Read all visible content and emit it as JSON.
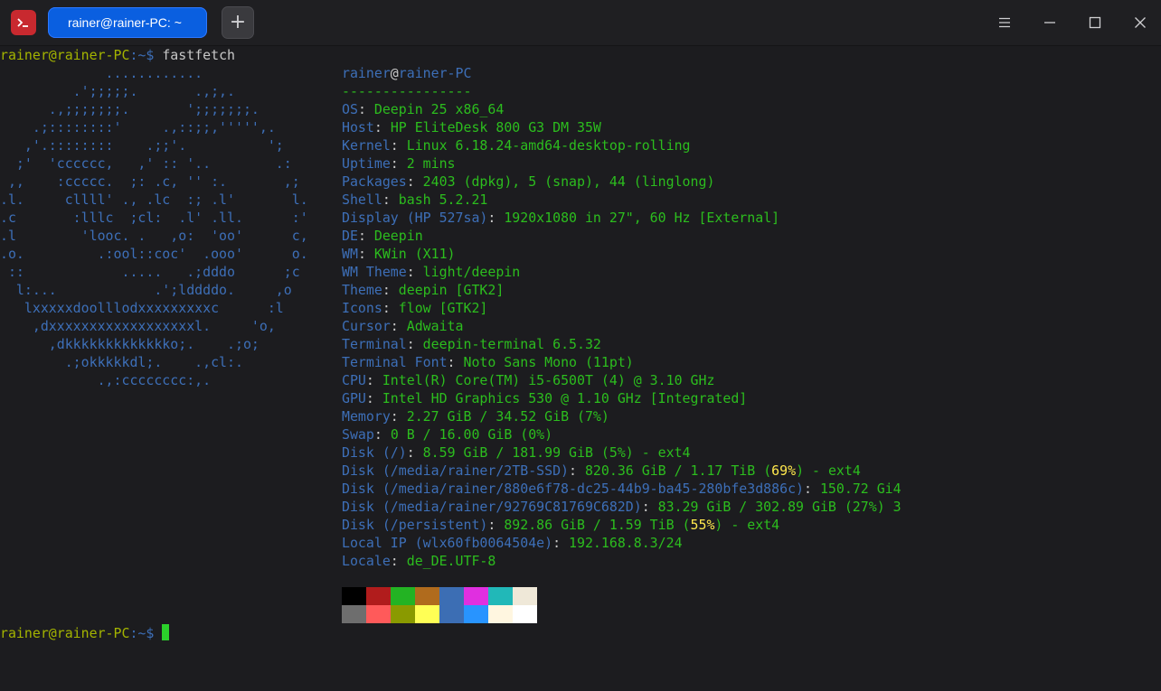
{
  "window": {
    "tab_label": "rainer@rainer-PC: ~",
    "tab_close_glyph": "×",
    "new_tab_glyph": "+",
    "icons": [
      "terminal-app-icon",
      "tab-close-icon",
      "plus-icon",
      "hamburger-menu-icon",
      "minimize-icon",
      "maximize-icon",
      "close-icon"
    ]
  },
  "prompt": {
    "user_host": "rainer@rainer-PC",
    "path": ":~$ ",
    "command": "fastfetch"
  },
  "ascii_art": [
    "             ............",
    "         .';;;;;.       .,;,.",
    "      .,;;;;;;;.       ';;;;;;;.",
    "    .;::::::::'     .,::;;,''''',.",
    "   ,'.::::::::    .;;'.          ';",
    "  ;'  'cccccc,   ,' :: '..        .:",
    " ,,    :ccccc.  ;: .c, '' :.       ,;",
    ".l.     cllll' ., .lc  :; .l'       l.",
    ".c       :lllc  ;cl:  .l' .ll.      :'",
    ".l        'looc. .   ,o:  'oo'      c,",
    ".o.         .:ool::coc'  .ooo'      o.",
    " ::            .....   .;dddo      ;c",
    "  l:...            .';lddddo.     ,o",
    "   lxxxxxdoolllodxxxxxxxxxc      :l",
    "    ,dxxxxxxxxxxxxxxxxxxl.     'o,",
    "      ,dkkkkkkkkkkkkko;.    .;o;",
    "        .;okkkkkdl;.    .,cl:.",
    "            .,:cccccccc:,."
  ],
  "info": {
    "user": "rainer",
    "at": "@",
    "host": "rainer-PC",
    "separator": "----------------",
    "rows": [
      {
        "key": "OS",
        "sep": ": ",
        "value": "Deepin 25 x86_64"
      },
      {
        "key": "Host",
        "sep": ": ",
        "value": "HP EliteDesk 800 G3 DM 35W"
      },
      {
        "key": "Kernel",
        "sep": ": ",
        "value": "Linux 6.18.24-amd64-desktop-rolling"
      },
      {
        "key": "Uptime",
        "sep": ": ",
        "value": "2 mins"
      },
      {
        "key": "Packages",
        "sep": ": ",
        "value": "2403 (dpkg), 5 (snap), 44 (linglong)"
      },
      {
        "key": "Shell",
        "sep": ": ",
        "value": "bash 5.2.21"
      },
      {
        "key": "Display (HP 527sa)",
        "sep": ": ",
        "value": "1920x1080 in 27\", 60 Hz [External]"
      },
      {
        "key": "DE",
        "sep": ": ",
        "value": "Deepin"
      },
      {
        "key": "WM",
        "sep": ": ",
        "value": "KWin (X11)"
      },
      {
        "key": "WM Theme",
        "sep": ": ",
        "value": "light/deepin"
      },
      {
        "key": "Theme",
        "sep": ": ",
        "value": "deepin [GTK2]"
      },
      {
        "key": "Icons",
        "sep": ": ",
        "value": "flow [GTK2]"
      },
      {
        "key": "Cursor",
        "sep": ": ",
        "value": "Adwaita"
      },
      {
        "key": "Terminal",
        "sep": ": ",
        "value": "deepin-terminal 6.5.32"
      },
      {
        "key": "Terminal Font",
        "sep": ": ",
        "value": "Noto Sans Mono (11pt)"
      },
      {
        "key": "CPU",
        "sep": ": ",
        "value": "Intel(R) Core(TM) i5-6500T (4) @ 3.10 GHz"
      },
      {
        "key": "GPU",
        "sep": ": ",
        "value": "Intel HD Graphics 530 @ 1.10 GHz [Integrated]"
      },
      {
        "key": "Memory",
        "sep": ": ",
        "value": "2.27 GiB / 34.52 GiB (7%)"
      },
      {
        "key": "Swap",
        "sep": ": ",
        "value": "0 B / 16.00 GiB (0%)"
      },
      {
        "key": "Disk (/)",
        "sep": ": ",
        "value": "8.59 GiB / 181.99 GiB (5%) - ext4"
      },
      {
        "key": "Disk (/media/rainer/2TB-SSD)",
        "sep": ": ",
        "value": "820.36 GiB / 1.17 TiB (",
        "hl": "69%",
        "tail": ") - ext4"
      },
      {
        "key": "Disk (/media/rainer/880e6f78-dc25-44b9-ba45-280bfe3d886c)",
        "sep": ": ",
        "value": "150.72 Gi4"
      },
      {
        "key": "Disk (/media/rainer/92769C81769C682D)",
        "sep": ": ",
        "value": "83.29 GiB / 302.89 GiB (27%) 3"
      },
      {
        "key": "Disk (/persistent)",
        "sep": ": ",
        "value": "892.86 GiB / 1.59 TiB (",
        "hl": "55%",
        "tail": ") - ext4"
      },
      {
        "key": "Local IP (wlx60fb0064504e)",
        "sep": ": ",
        "value": "192.168.8.3/24"
      },
      {
        "key": "Locale",
        "sep": ": ",
        "value": "de_DE.UTF-8"
      }
    ]
  },
  "palette": {
    "top": [
      "#000000",
      "#b11c1c",
      "#23b323",
      "#b06b1d",
      "#3c6eb4",
      "#e02fe0",
      "#21b8b8",
      "#efe8d8"
    ],
    "bottom": [
      "#6e6e6e",
      "#ff5a5a",
      "#8a9a00",
      "#ffff55",
      "#3c6eb4",
      "#2894ff",
      "#fff6e0",
      "#ffffff"
    ]
  },
  "colors": {
    "prompt_user": "#a4b400",
    "path": "#3d6fb8",
    "info_key": "#3d6fb8",
    "info_value": "#2cbd1e",
    "highlight": "#ffe84d",
    "accent_tab": "#0a5fe0"
  }
}
